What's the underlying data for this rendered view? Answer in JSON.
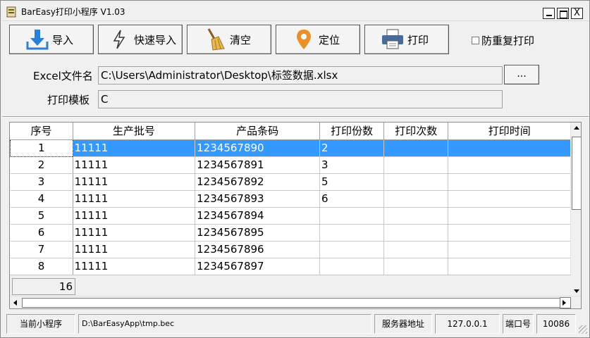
{
  "window": {
    "title": "BarEasy打印小程序 V1.03",
    "close_glyph": "X"
  },
  "toolbar": {
    "import_label": "导入",
    "quick_import_label": "快速导入",
    "clear_label": "清空",
    "locate_label": "定位",
    "print_label": "打印",
    "prevent_duplicate_label": "防重复打印",
    "prevent_duplicate_checked": false
  },
  "form": {
    "excel_label": "Excel文件名",
    "excel_value": "C:\\Users\\Administrator\\Desktop\\标签数据.xlsx",
    "browse_label": "...",
    "template_label": "打印模板",
    "template_value": "C"
  },
  "table": {
    "columns": [
      "序号",
      "生产批号",
      "产品条码",
      "打印份数",
      "打印次数",
      "打印时间"
    ],
    "rows": [
      [
        "1",
        "11111",
        "1234567890",
        "2",
        "",
        ""
      ],
      [
        "2",
        "11111",
        "1234567891",
        "3",
        "",
        ""
      ],
      [
        "3",
        "11111",
        "1234567892",
        "5",
        "",
        ""
      ],
      [
        "4",
        "11111",
        "1234567893",
        "6",
        "",
        ""
      ],
      [
        "5",
        "11111",
        "1234567894",
        "",
        "",
        ""
      ],
      [
        "6",
        "11111",
        "1234567895",
        "",
        "",
        ""
      ],
      [
        "7",
        "11111",
        "1234567896",
        "",
        "",
        ""
      ],
      [
        "8",
        "11111",
        "1234567897",
        "",
        "",
        ""
      ]
    ],
    "selected_row": 0,
    "row_count": "16"
  },
  "statusbar": {
    "current_app_label": "当前小程序",
    "current_app_path": "D:\\BarEasyApp\\tmp.bec",
    "server_label": "服务器地址",
    "server_value": "127.0.0.1",
    "port_label": "端口号",
    "port_value": "10086"
  },
  "colors": {
    "selection": "#3399ff",
    "import_icon": "#2b7fd4",
    "locate_icon": "#e8912a",
    "quick_import_icon": "#333333",
    "clear_icon": "#d9a23a",
    "print_icon": "#4a6a9a"
  },
  "icons": {
    "app": "app-icon",
    "import": "download-arrow-icon",
    "quick_import": "lightning-icon",
    "clear": "broom-icon",
    "locate": "map-pin-icon",
    "print": "printer-icon"
  }
}
